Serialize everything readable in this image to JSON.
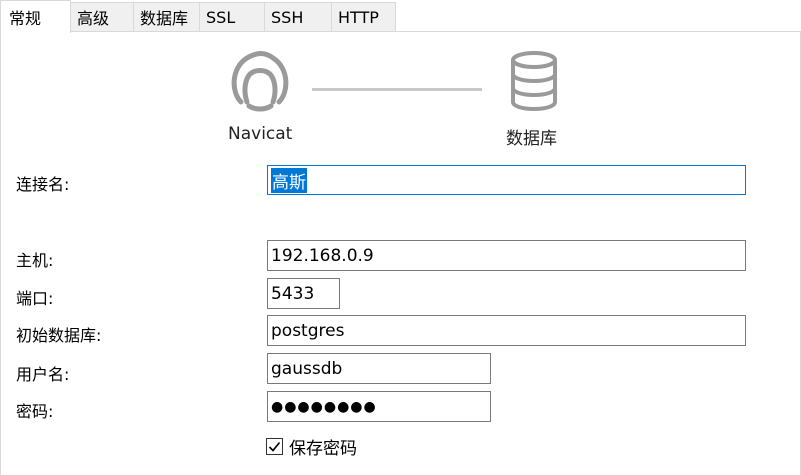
{
  "tabs": [
    {
      "label": "常规",
      "active": true
    },
    {
      "label": "高级"
    },
    {
      "label": "数据库"
    },
    {
      "label": "SSL"
    },
    {
      "label": "SSH"
    },
    {
      "label": "HTTP"
    }
  ],
  "diagram": {
    "left_label": "Navicat",
    "right_label": "数据库",
    "left_icon": "navicat-logo-icon",
    "right_icon": "database-icon"
  },
  "form": {
    "connection_name": {
      "label": "连接名:",
      "value": "高斯"
    },
    "host": {
      "label": "主机:",
      "value": "192.168.0.9"
    },
    "port": {
      "label": "端口:",
      "value": "5433"
    },
    "initial_database": {
      "label": "初始数据库:",
      "value": "postgres"
    },
    "username": {
      "label": "用户名:",
      "value": "gaussdb"
    },
    "password": {
      "label": "密码:",
      "value": "●●●●●●●●"
    },
    "save_password": {
      "label": "保存密码",
      "checked": true
    }
  },
  "colors": {
    "accent": "#0078d7",
    "field_border": "#7a7a7a",
    "tab_border": "#d9d9d9",
    "icon_gray": "#9a9a9a"
  }
}
